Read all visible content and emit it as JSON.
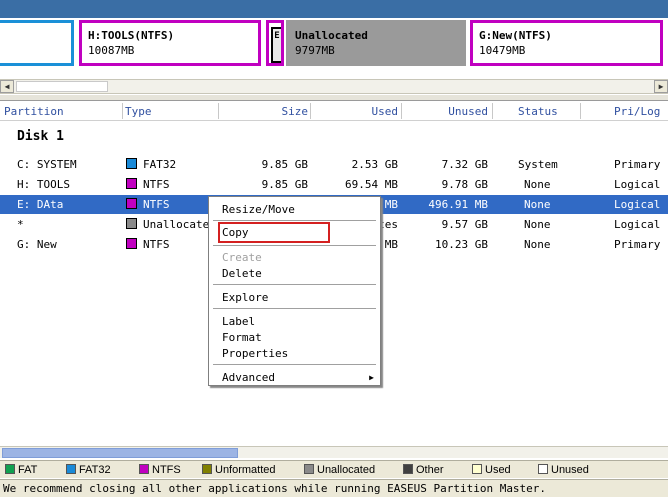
{
  "disk_map": {
    "blocks": [
      {
        "title": "",
        "size": ""
      },
      {
        "title": "H:TOOLS(NTFS)",
        "size": "10087MB"
      },
      {
        "title": "E",
        "size": ""
      },
      {
        "title": "Unallocated",
        "size": "9797MB"
      },
      {
        "title": "G:New(NTFS)",
        "size": "10479MB"
      }
    ]
  },
  "table": {
    "headers": [
      "Partition",
      "Type",
      "Size",
      "Used",
      "Unused",
      "Status",
      "Pri/Log"
    ],
    "disk_label": "Disk 1",
    "rows": [
      {
        "partition": "C: SYSTEM",
        "type": "FAT32",
        "type_color": "#1a8ad8",
        "size": "9.85 GB",
        "used": "2.53 GB",
        "unused": "7.32 GB",
        "status": "System",
        "prilog": "Primary"
      },
      {
        "partition": "H: TOOLS",
        "type": "NTFS",
        "type_color": "#c000c0",
        "size": "9.85 GB",
        "used": "69.54 MB",
        "unused": "9.78 GB",
        "status": "None",
        "prilog": "Logical"
      },
      {
        "partition": "E: DAta",
        "type": "NTFS",
        "type_color": "#c000c0",
        "size": "",
        "used": "MB",
        "unused": "496.91 MB",
        "status": "None",
        "prilog": "Logical"
      },
      {
        "partition": "*",
        "type": "Unallocated",
        "type_color": "#8a8a8a",
        "size": "",
        "used": "tes",
        "unused": "9.57 GB",
        "status": "None",
        "prilog": "Logical"
      },
      {
        "partition": "G: New",
        "type": "NTFS",
        "type_color": "#c000c0",
        "size": "",
        "used": "MB",
        "unused": "10.23 GB",
        "status": "None",
        "prilog": "Primary"
      }
    ]
  },
  "context_menu": {
    "items": {
      "resize_move": "Resize/Move",
      "copy": "Copy",
      "create": "Create",
      "delete": "Delete",
      "explore": "Explore",
      "label": "Label",
      "format": "Format",
      "properties": "Properties",
      "advanced": "Advanced"
    },
    "highlight_color": "#d42020"
  },
  "legend": {
    "items": [
      {
        "label": "FAT",
        "color": "#10a050"
      },
      {
        "label": "FAT32",
        "color": "#1a8ad8"
      },
      {
        "label": "NTFS",
        "color": "#c000c0"
      },
      {
        "label": "Unformatted",
        "color": "#808000"
      },
      {
        "label": "Unallocated",
        "color": "#8a8a8a"
      },
      {
        "label": "Other",
        "color": "#404040"
      },
      {
        "label": "Used",
        "color": "#ffffd0"
      },
      {
        "label": "Unused",
        "color": "#ffffff"
      }
    ]
  },
  "status_bar": {
    "message": "We recommend closing all other applications while running EASEUS Partition Master."
  },
  "colors": {
    "selection": "#316ac5",
    "header_text": "#3050a0",
    "title_strip": "#3a6ea5"
  }
}
